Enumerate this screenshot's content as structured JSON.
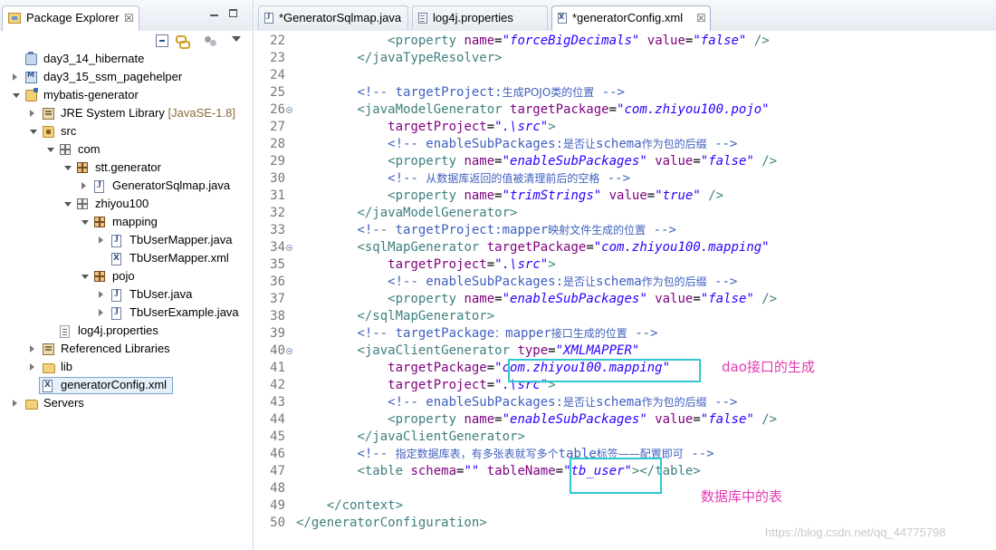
{
  "explorer": {
    "title": "Package Explorer",
    "close_glyph": "☒",
    "icons": [
      "package-explorer-icon",
      "collapse-all-icon",
      "link-with-editor-icon",
      "filter-icon",
      "view-menu-icon",
      "minimize-icon",
      "maximize-icon"
    ],
    "tree": [
      {
        "label": "day3_14_hibernate",
        "icon": "project"
      },
      {
        "label": "day3_15_ssm_pagehelper",
        "icon": "maven-project"
      },
      {
        "label": "mybatis-generator",
        "icon": "java-project"
      },
      {
        "label": "JRE System Library",
        "decoration": "[JavaSE-1.8]",
        "icon": "library"
      },
      {
        "label": "src",
        "icon": "source-folder"
      },
      {
        "label": "com",
        "icon": "package-empty"
      },
      {
        "label": "stt.generator",
        "icon": "package"
      },
      {
        "label": "GeneratorSqlmap.java",
        "icon": "java-file"
      },
      {
        "label": "zhiyou100",
        "icon": "package-empty"
      },
      {
        "label": "mapping",
        "icon": "package"
      },
      {
        "label": "TbUserMapper.java",
        "icon": "java-file"
      },
      {
        "label": "TbUserMapper.xml",
        "icon": "xml-file"
      },
      {
        "label": "pojo",
        "icon": "package"
      },
      {
        "label": "TbUser.java",
        "icon": "java-file"
      },
      {
        "label": "TbUserExample.java",
        "icon": "java-file"
      },
      {
        "label": "log4j.properties",
        "icon": "properties-file"
      },
      {
        "label": "Referenced Libraries",
        "icon": "library"
      },
      {
        "label": "lib",
        "icon": "folder"
      },
      {
        "label": "generatorConfig.xml",
        "icon": "xml-file",
        "selected": true
      },
      {
        "label": "Servers",
        "icon": "folder"
      }
    ]
  },
  "editor": {
    "tabs": [
      {
        "label": "*GeneratorSqlmap.java",
        "icon": "java-file",
        "active": false
      },
      {
        "label": "log4j.properties",
        "icon": "properties-file",
        "active": false
      },
      {
        "label": "*generatorConfig.xml",
        "icon": "xml-file",
        "active": true
      }
    ],
    "close_glyph": "☒",
    "lines": [
      {
        "num": "22",
        "tokens": [
          [
            "p",
            "            "
          ],
          [
            "t",
            "<property "
          ],
          [
            "a",
            "name"
          ],
          [
            "p",
            "="
          ],
          [
            "v",
            "\"forceBigDecimals\""
          ],
          [
            "p",
            " "
          ],
          [
            "a",
            "value"
          ],
          [
            "p",
            "="
          ],
          [
            "v",
            "\"false\""
          ],
          [
            "p",
            " "
          ],
          [
            "t",
            "/>"
          ]
        ]
      },
      {
        "num": "23",
        "tokens": [
          [
            "p",
            "        "
          ],
          [
            "t",
            "</javaTypeResolver>"
          ]
        ]
      },
      {
        "num": "24",
        "tokens": []
      },
      {
        "num": "25",
        "tokens": [
          [
            "p",
            "        "
          ],
          [
            "c",
            "<!-- targetProject:"
          ],
          [
            "cc",
            "生成POJO类的位置"
          ],
          [
            "c",
            " -->"
          ]
        ]
      },
      {
        "num": "26",
        "fold": true,
        "tokens": [
          [
            "p",
            "        "
          ],
          [
            "t",
            "<javaModelGenerator "
          ],
          [
            "a",
            "targetPackage"
          ],
          [
            "p",
            "="
          ],
          [
            "v",
            "\"com.zhiyou100.pojo\""
          ]
        ]
      },
      {
        "num": "27",
        "tokens": [
          [
            "p",
            "            "
          ],
          [
            "a",
            "targetProject"
          ],
          [
            "p",
            "="
          ],
          [
            "v",
            "\".\\src\""
          ],
          [
            "t",
            ">"
          ]
        ]
      },
      {
        "num": "28",
        "tokens": [
          [
            "p",
            "            "
          ],
          [
            "c",
            "<!-- enableSubPackages:"
          ],
          [
            "cc",
            "是否让"
          ],
          [
            "c",
            "schema"
          ],
          [
            "cc",
            "作为包的后缀"
          ],
          [
            "c",
            " -->"
          ]
        ]
      },
      {
        "num": "29",
        "tokens": [
          [
            "p",
            "            "
          ],
          [
            "t",
            "<property "
          ],
          [
            "a",
            "name"
          ],
          [
            "p",
            "="
          ],
          [
            "v",
            "\"enableSubPackages\""
          ],
          [
            "p",
            " "
          ],
          [
            "a",
            "value"
          ],
          [
            "p",
            "="
          ],
          [
            "v",
            "\"false\""
          ],
          [
            "p",
            " "
          ],
          [
            "t",
            "/>"
          ]
        ]
      },
      {
        "num": "30",
        "tokens": [
          [
            "p",
            "            "
          ],
          [
            "c",
            "<!-- "
          ],
          [
            "cc",
            "从数据库返回的值被清理前后的空格"
          ],
          [
            "c",
            " -->"
          ]
        ]
      },
      {
        "num": "31",
        "tokens": [
          [
            "p",
            "            "
          ],
          [
            "t",
            "<property "
          ],
          [
            "a",
            "name"
          ],
          [
            "p",
            "="
          ],
          [
            "v",
            "\"trimStrings\""
          ],
          [
            "p",
            " "
          ],
          [
            "a",
            "value"
          ],
          [
            "p",
            "="
          ],
          [
            "v",
            "\"true\""
          ],
          [
            "p",
            " "
          ],
          [
            "t",
            "/>"
          ]
        ]
      },
      {
        "num": "32",
        "tokens": [
          [
            "p",
            "        "
          ],
          [
            "t",
            "</javaModelGenerator>"
          ]
        ]
      },
      {
        "num": "33",
        "tokens": [
          [
            "p",
            "        "
          ],
          [
            "c",
            "<!-- targetProject:mapper"
          ],
          [
            "cc",
            "映射文件生成的位置"
          ],
          [
            "c",
            " -->"
          ]
        ]
      },
      {
        "num": "34",
        "fold": true,
        "tokens": [
          [
            "p",
            "        "
          ],
          [
            "t",
            "<sqlMapGenerator "
          ],
          [
            "a",
            "targetPackage"
          ],
          [
            "p",
            "="
          ],
          [
            "v",
            "\"com.zhiyou100.mapping\""
          ]
        ]
      },
      {
        "num": "35",
        "tokens": [
          [
            "p",
            "            "
          ],
          [
            "a",
            "targetProject"
          ],
          [
            "p",
            "="
          ],
          [
            "v",
            "\".\\src\""
          ],
          [
            "t",
            ">"
          ]
        ]
      },
      {
        "num": "36",
        "tokens": [
          [
            "p",
            "            "
          ],
          [
            "c",
            "<!-- enableSubPackages:"
          ],
          [
            "cc",
            "是否让"
          ],
          [
            "c",
            "schema"
          ],
          [
            "cc",
            "作为包的后缀"
          ],
          [
            "c",
            " -->"
          ]
        ]
      },
      {
        "num": "37",
        "tokens": [
          [
            "p",
            "            "
          ],
          [
            "t",
            "<property "
          ],
          [
            "a",
            "name"
          ],
          [
            "p",
            "="
          ],
          [
            "v",
            "\"enableSubPackages\""
          ],
          [
            "p",
            " "
          ],
          [
            "a",
            "value"
          ],
          [
            "p",
            "="
          ],
          [
            "v",
            "\"false\""
          ],
          [
            "p",
            " "
          ],
          [
            "t",
            "/>"
          ]
        ]
      },
      {
        "num": "38",
        "tokens": [
          [
            "p",
            "        "
          ],
          [
            "t",
            "</sqlMapGenerator>"
          ]
        ]
      },
      {
        "num": "39",
        "tokens": [
          [
            "p",
            "        "
          ],
          [
            "c",
            "<!-- targetPackage"
          ],
          [
            "cc",
            "："
          ],
          [
            "c",
            "mapper"
          ],
          [
            "cc",
            "接口生成的位置"
          ],
          [
            "c",
            " -->"
          ]
        ]
      },
      {
        "num": "40",
        "fold": true,
        "tokens": [
          [
            "p",
            "        "
          ],
          [
            "t",
            "<javaClientGenerator "
          ],
          [
            "a",
            "type"
          ],
          [
            "p",
            "="
          ],
          [
            "v",
            "\"XMLMAPPER\""
          ]
        ]
      },
      {
        "num": "41",
        "tokens": [
          [
            "p",
            "            "
          ],
          [
            "a",
            "targetPackage"
          ],
          [
            "p",
            "="
          ],
          [
            "v",
            "\"com.zhiyou100.mapping\""
          ]
        ]
      },
      {
        "num": "42",
        "tokens": [
          [
            "p",
            "            "
          ],
          [
            "a",
            "targetProject"
          ],
          [
            "p",
            "="
          ],
          [
            "v",
            "\".\\src\""
          ],
          [
            "t",
            ">"
          ]
        ]
      },
      {
        "num": "43",
        "tokens": [
          [
            "p",
            "            "
          ],
          [
            "c",
            "<!-- enableSubPackages:"
          ],
          [
            "cc",
            "是否让"
          ],
          [
            "c",
            "schema"
          ],
          [
            "cc",
            "作为包的后缀"
          ],
          [
            "c",
            " -->"
          ]
        ]
      },
      {
        "num": "44",
        "tokens": [
          [
            "p",
            "            "
          ],
          [
            "t",
            "<property "
          ],
          [
            "a",
            "name"
          ],
          [
            "p",
            "="
          ],
          [
            "v",
            "\"enableSubPackages\""
          ],
          [
            "p",
            " "
          ],
          [
            "a",
            "value"
          ],
          [
            "p",
            "="
          ],
          [
            "v",
            "\"false\""
          ],
          [
            "p",
            " "
          ],
          [
            "t",
            "/>"
          ]
        ]
      },
      {
        "num": "45",
        "tokens": [
          [
            "p",
            "        "
          ],
          [
            "t",
            "</javaClientGenerator>"
          ]
        ]
      },
      {
        "num": "46",
        "tokens": [
          [
            "p",
            "        "
          ],
          [
            "c",
            "<!-- "
          ],
          [
            "cc",
            "指定数据库表，有多张表就写多个"
          ],
          [
            "c",
            "table"
          ],
          [
            "cc",
            "标签——配置即可"
          ],
          [
            "c",
            " -->"
          ]
        ]
      },
      {
        "num": "47",
        "tokens": [
          [
            "p",
            "        "
          ],
          [
            "t",
            "<table "
          ],
          [
            "a",
            "schema"
          ],
          [
            "p",
            "="
          ],
          [
            "v",
            "\"\""
          ],
          [
            "p",
            " "
          ],
          [
            "a",
            "tableName"
          ],
          [
            "p",
            "="
          ],
          [
            "v",
            "\"tb_user\""
          ],
          [
            "t",
            "></table>"
          ]
        ]
      },
      {
        "num": "48",
        "tokens": []
      },
      {
        "num": "49",
        "tokens": [
          [
            "p",
            "    "
          ],
          [
            "t",
            "</context>"
          ]
        ]
      },
      {
        "num": "50",
        "tokens": [
          [
            "t",
            "</generatorConfiguration>"
          ]
        ]
      }
    ]
  },
  "annotations": {
    "dao_label": "dao接口的生成",
    "table_label": "数据库中的表",
    "box_color": "#30c8d0",
    "text_color": "#e23cb0"
  },
  "watermark": "https://blog.csdn.net/qq_44775798",
  "colors": {
    "tag": "#3f7f7f",
    "attribute": "#7f007f",
    "value": "#2a00ff",
    "comment": "#3f5fbf",
    "line_number": "#787878"
  }
}
